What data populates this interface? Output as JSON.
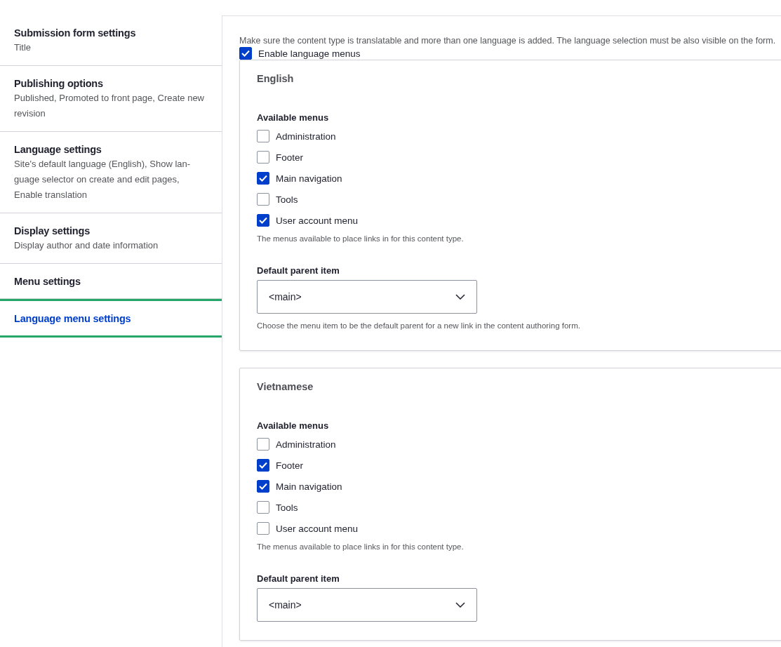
{
  "sidebar": {
    "items": [
      {
        "title": "Submission form settings",
        "summary": "Title",
        "selected": false
      },
      {
        "title": "Publishing options",
        "summary": "Published, Promoted to front page, Create new revision",
        "selected": false
      },
      {
        "title": "Language settings",
        "summary": "Site's default language (English), Show lan-guage selector on create and edit pages, Enable translation",
        "selected": false
      },
      {
        "title": "Display settings",
        "summary": "Display author and date information",
        "selected": false
      },
      {
        "title": "Menu settings",
        "selected": false
      },
      {
        "title": "Language menu settings",
        "selected": true
      }
    ]
  },
  "main": {
    "description": "Make sure the content type is translatable and more than one language is added. The language selection must be also visible on the form.",
    "enable": {
      "label": "Enable language menus",
      "checked": true
    },
    "languages": [
      {
        "legend": "English",
        "menus_label": "Available menus",
        "menus": [
          {
            "label": "Administration",
            "checked": false
          },
          {
            "label": "Footer",
            "checked": false
          },
          {
            "label": "Main navigation",
            "checked": true
          },
          {
            "label": "Tools",
            "checked": false
          },
          {
            "label": "User account menu",
            "checked": true
          }
        ],
        "menus_help": "The menus available to place links in for this content type.",
        "parent_label": "Default parent item",
        "parent_value": "<main>",
        "parent_help": "Choose the menu item to be the default parent for a new link in the content authoring form."
      },
      {
        "legend": "Vietnamese",
        "menus_label": "Available menus",
        "menus": [
          {
            "label": "Administration",
            "checked": false
          },
          {
            "label": "Footer",
            "checked": true
          },
          {
            "label": "Main navigation",
            "checked": true
          },
          {
            "label": "Tools",
            "checked": false
          },
          {
            "label": "User account menu",
            "checked": false
          }
        ],
        "menus_help": "The menus available to place links in for this content type.",
        "parent_label": "Default parent item",
        "parent_value": "<main>"
      }
    ]
  }
}
